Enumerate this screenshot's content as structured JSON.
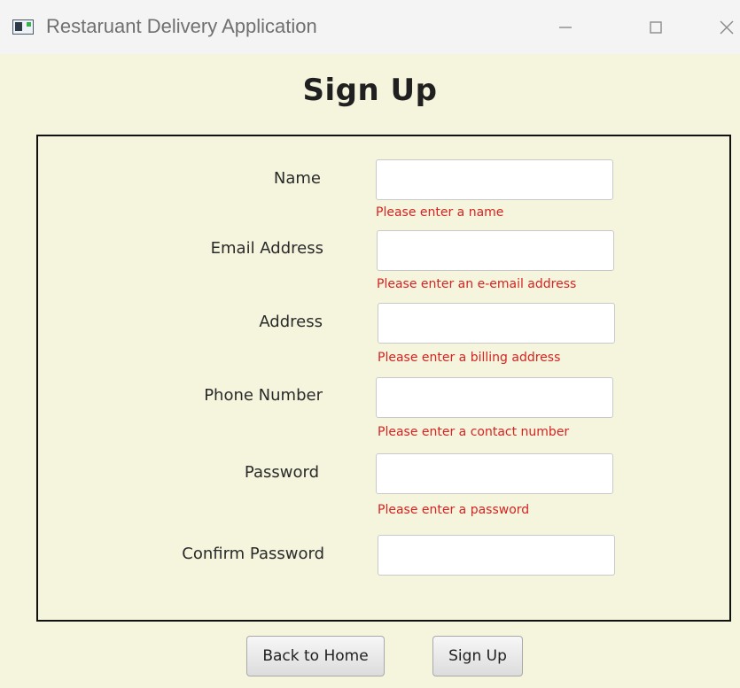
{
  "window": {
    "title": "Restaruant Delivery Application"
  },
  "page": {
    "heading": "Sign Up"
  },
  "form": {
    "fields": [
      {
        "label": "Name",
        "value": "",
        "error": "Please enter a name"
      },
      {
        "label": "Email Address",
        "value": "",
        "error": "Please enter an e-email address"
      },
      {
        "label": "Address",
        "value": "",
        "error": "Please enter a billing address"
      },
      {
        "label": "Phone Number",
        "value": "",
        "error": "Please enter a contact number"
      },
      {
        "label": "Password",
        "value": "",
        "error": "Please enter a password"
      },
      {
        "label": "Confirm Password",
        "value": ""
      }
    ]
  },
  "buttons": {
    "back": "Back to Home",
    "signup": "Sign Up"
  },
  "icons": {
    "app": "app-window-icon",
    "minimize": "minimize-icon",
    "maximize": "maximize-icon",
    "close": "close-icon"
  },
  "colors": {
    "background": "#f5f4dc",
    "error": "#d42424",
    "border": "#111111"
  }
}
